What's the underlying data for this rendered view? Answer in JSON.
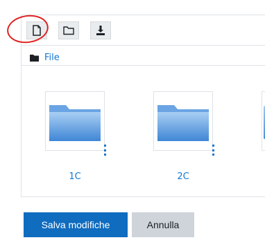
{
  "toolbar": {
    "add_file_icon": "file-icon",
    "create_folder_icon": "folder-icon",
    "download_icon": "download-icon"
  },
  "path": {
    "folder_icon": "folder-solid-icon",
    "label": "File"
  },
  "files": [
    {
      "name": "1C",
      "icon": "folder-icon"
    },
    {
      "name": "2C",
      "icon": "folder-icon"
    }
  ],
  "actions": {
    "save_label": "Salva modifiche",
    "cancel_label": "Annulla"
  },
  "colors": {
    "link": "#1177d1",
    "primary_button": "#0f6cbf",
    "secondary_button": "#ced4da",
    "annotation": "#e02020"
  }
}
